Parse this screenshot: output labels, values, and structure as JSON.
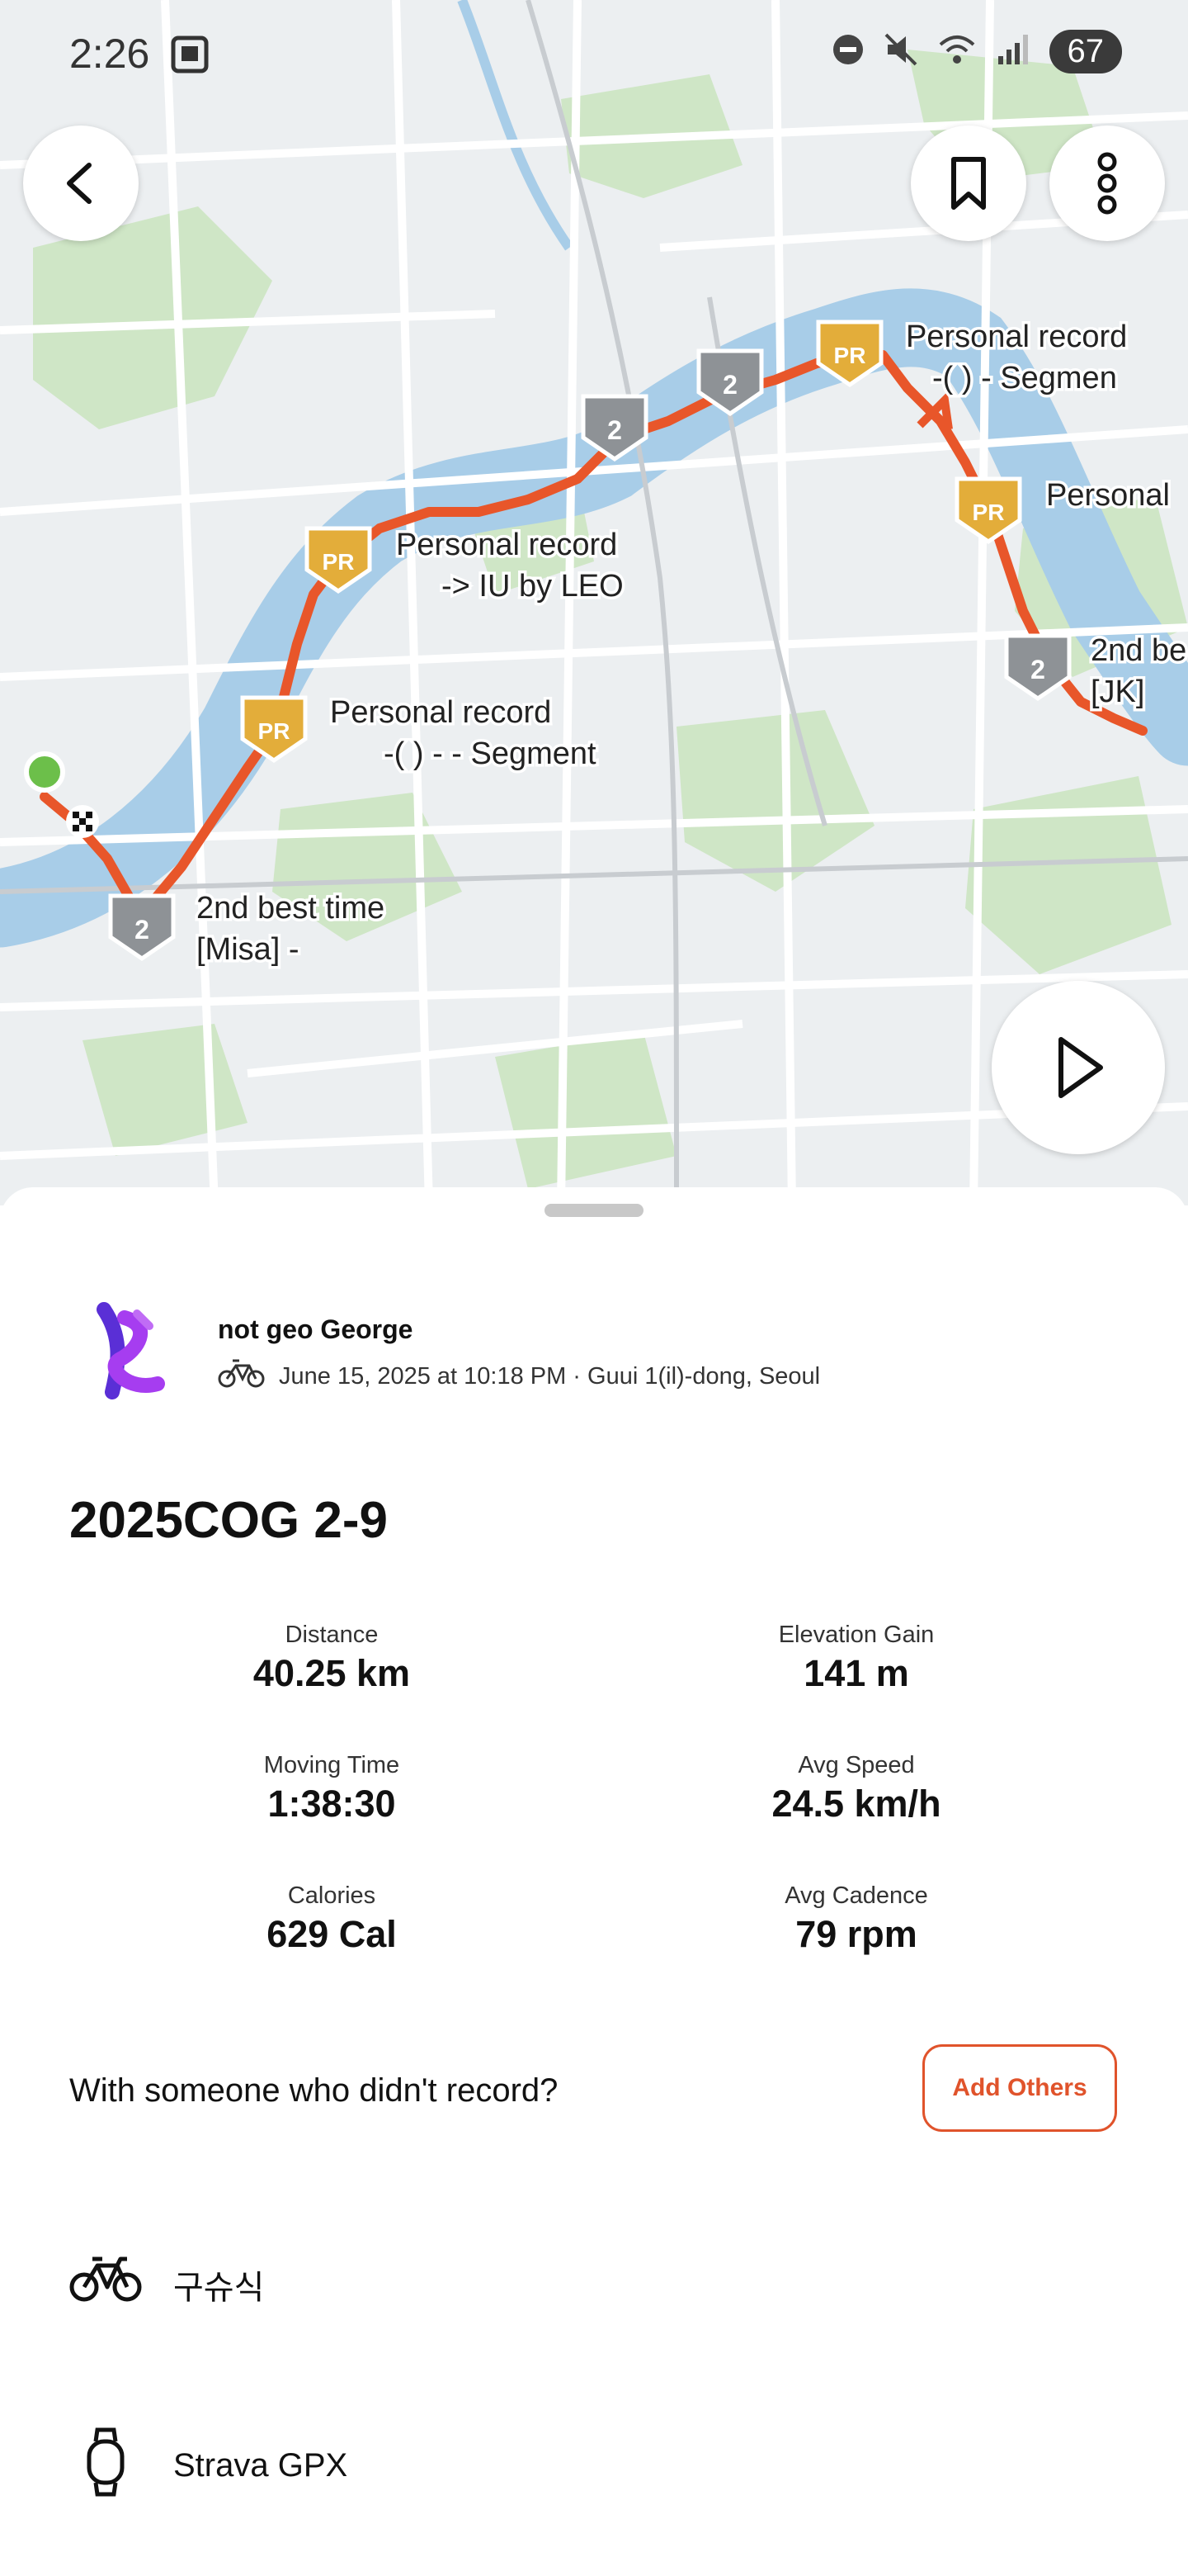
{
  "status_bar": {
    "time": "2:26",
    "battery": "67"
  },
  "map": {
    "labels": [
      {
        "name": "label-pr-1",
        "line1": "Personal record",
        "line2": "-( )  -   Segmen"
      },
      {
        "name": "label-pr-2",
        "line1": "Personal",
        "line2": ""
      },
      {
        "name": "label-pr-3",
        "line1": "Personal record",
        "line2": "-> IU    by LEO"
      },
      {
        "name": "label-pr-4",
        "line1": "Personal record",
        "line2": "-( )  -  -  Segment"
      },
      {
        "name": "label-2nd-1",
        "line1": "2nd be",
        "line2": "[JK]"
      },
      {
        "name": "label-2nd-2",
        "line1": "2nd best time",
        "line2": "[Misa]   -"
      }
    ],
    "badge_pr": "PR",
    "badge_2": "2"
  },
  "activity": {
    "athlete": "not geo George",
    "meta": "June 15, 2025 at 10:18 PM · Guui 1(il)-dong, Seoul",
    "title": "2025COG 2-9",
    "stats": [
      {
        "label": "Distance",
        "value": "40.25 km"
      },
      {
        "label": "Elevation Gain",
        "value": "141 m"
      },
      {
        "label": "Moving Time",
        "value": "1:38:30"
      },
      {
        "label": "Avg Speed",
        "value": "24.5 km/h"
      },
      {
        "label": "Calories",
        "value": "629 Cal"
      },
      {
        "label": "Avg Cadence",
        "value": "79 rpm"
      }
    ],
    "with_question": "With someone who didn't record?",
    "add_others": "Add Others",
    "gear": "구슈식",
    "device": "Strava GPX"
  },
  "colors": {
    "accent": "#e0532b",
    "route": "#e8562a",
    "pr_gold": "#e3ad3a",
    "silver": "#8e9296",
    "water": "#a8cde8",
    "park": "#cde6c3"
  }
}
